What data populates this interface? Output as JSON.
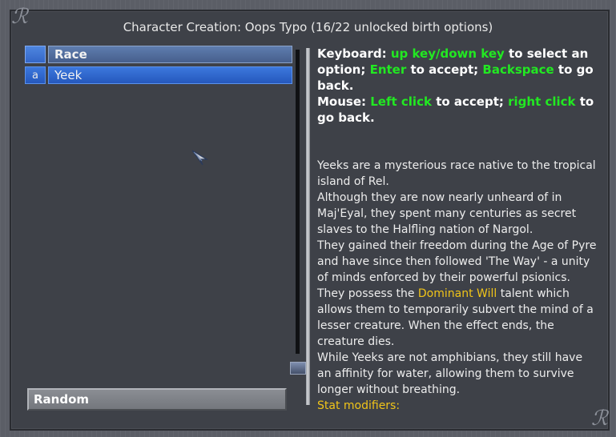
{
  "window": {
    "title": "Character Creation: Oops Typo (16/22 unlocked birth options)"
  },
  "list": {
    "header_label": "Race",
    "rows": [
      {
        "key": "a",
        "label": "Yeek"
      }
    ]
  },
  "random_button": "Random",
  "help": {
    "keyboard_label": "Keyboard:",
    "updown": "up key/down key",
    "to_select": "to select an option;",
    "enter": "Enter",
    "to_accept1": "to accept;",
    "backspace": "Backspace",
    "to_go_back1": "to go back.",
    "mouse_label": "Mouse:",
    "left_click": "Left click",
    "to_accept2": "to accept;",
    "right_click": "right click",
    "to_go_back2": "to go back."
  },
  "description": {
    "p1": "Yeeks are a mysterious race native to the tropical island of Rel.",
    "p2": "Although they are now nearly unheard of in Maj'Eyal, they spent many centuries as secret slaves to the Halfling nation of Nargol.",
    "p3": "They gained their freedom during the Age of Pyre and have since then followed 'The Way' - a unity of minds enforced by their powerful psionics.",
    "p4_before": "They possess the",
    "talent": "Dominant Will",
    "p4_after": "talent which allows them to temporarily subvert the mind of a lesser creature. When the effect ends, the creature dies.",
    "p5": "While Yeeks are not amphibians, they still have an affinity for water, allowing them to survive longer without breathing.",
    "stat_modifiers": "Stat modifiers:"
  },
  "colors": {
    "highlight_green": "#22e822",
    "talent_gold": "#f0c419",
    "selection_blue": "#3466c7"
  }
}
